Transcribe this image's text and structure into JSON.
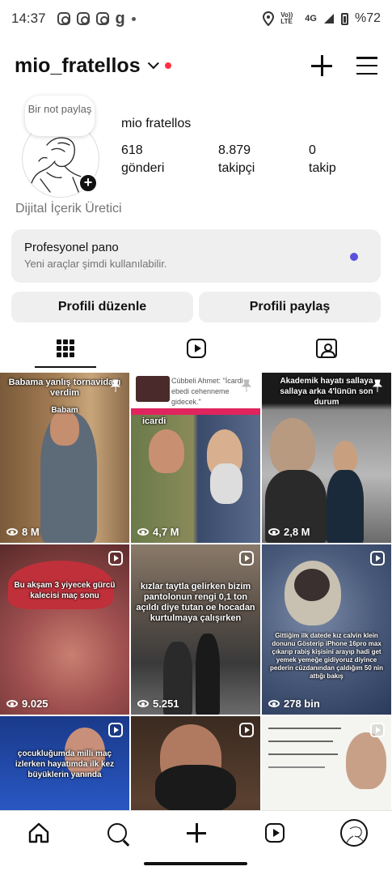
{
  "status_bar": {
    "time": "14:37",
    "network_lte": "Vo)) LTE",
    "network_4g": "4G",
    "battery": "%72",
    "notification_icons": [
      "instagram-icon",
      "instagram-icon",
      "instagram-icon",
      "g-app-icon",
      "dot-icon"
    ]
  },
  "header": {
    "username": "mio_fratellos",
    "has_unread_dot": true,
    "accent_dot_color": "#ff3040"
  },
  "profile": {
    "note_text": "Bir not paylaş",
    "full_name": "mio fratellos",
    "stats": [
      {
        "value": "618",
        "label": "gönderi"
      },
      {
        "value": "8.879",
        "label": "takipçi"
      },
      {
        "value": "0",
        "label": "takip"
      }
    ],
    "category": "Dijital İçerik Üretici"
  },
  "pro_panel": {
    "title": "Profesyonel pano",
    "subtitle": "Yeni araçlar şimdi kullanılabilir.",
    "dot_color": "#5851db"
  },
  "buttons": {
    "edit_profile": "Profili düzenle",
    "share_profile": "Profili paylaş"
  },
  "tabs": [
    {
      "icon": "grid-icon",
      "active": true
    },
    {
      "icon": "reels-icon",
      "active": false
    },
    {
      "icon": "tagged-icon",
      "active": false
    }
  ],
  "posts": [
    {
      "caption": "Babama yanlış tornavidayı verdim",
      "sub": "Babam",
      "views": "8 M",
      "pinned": true
    },
    {
      "caption": "Cübbeli Ahmet: \"İcardi ebedi cehenneme gidecek.\"",
      "sub": "icardi",
      "views": "4,7 M",
      "pinned": true
    },
    {
      "caption": "Akademik hayatı sallaya sallaya arka 4'lünün son durum",
      "sub": "",
      "views": "2,8 M",
      "pinned": true
    },
    {
      "caption": "Bu akşam 3 yiyecek gürcü kalecisi maç sonu",
      "sub": "",
      "views": "9.025",
      "pinned": false
    },
    {
      "caption": "kızlar taytla gelirken bizim pantolonun rengi 0,1 ton açıldı diye tutan oe hocadan kurtulmaya çalışırken",
      "sub": "",
      "views": "5.251",
      "pinned": false
    },
    {
      "caption": "Gittiğim ilk datede kız calvin klein donunu Gösterip iPhone 16pro max çıkarıp rabiş kişisini arayıp hadi get yemek yemeğe gidiyoruz diyince pederin cüzdanından çaldığım 50 nin attığı bakış",
      "sub": "",
      "views": "278 bin",
      "pinned": false
    },
    {
      "caption": "çocukluğumda milli maç izlerken hayatımda ilk kez büyüklerin yanında",
      "sub": "",
      "views": "",
      "pinned": false
    },
    {
      "caption": "",
      "sub": "",
      "views": "",
      "pinned": false
    },
    {
      "caption": "",
      "sub": "",
      "views": "",
      "pinned": false
    }
  ],
  "bottom_nav": [
    {
      "icon": "home-icon"
    },
    {
      "icon": "search-icon"
    },
    {
      "icon": "create-icon"
    },
    {
      "icon": "reels-icon"
    },
    {
      "icon": "profile-avatar"
    }
  ]
}
